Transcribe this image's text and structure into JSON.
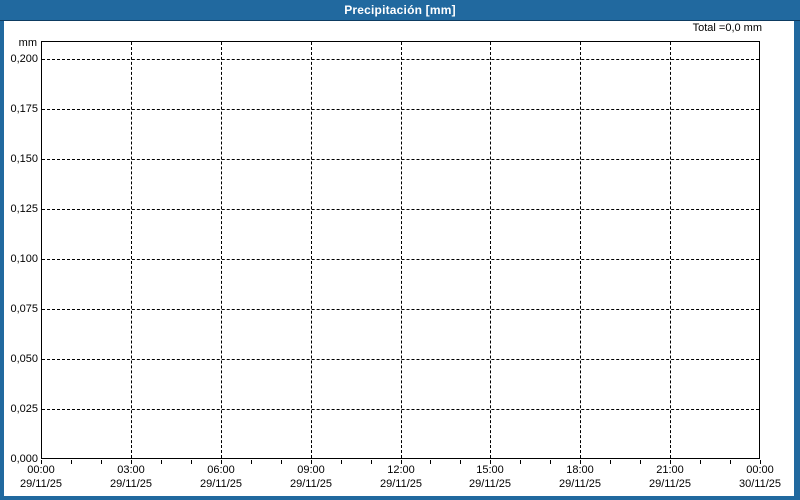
{
  "window": {
    "title": "Precipitación [mm]"
  },
  "header": {
    "total_label": "Total =0,0 mm"
  },
  "colors": {
    "titlebar_bg": "#21699f",
    "frame_border": "#21699f",
    "titlebar_underline": "#0d3b61",
    "title_text": "#ffffff",
    "plot_border": "#000000",
    "grid": "#000000",
    "text": "#000000",
    "background": "#ffffff"
  },
  "chart_data": {
    "type": "bar",
    "title": "Precipitación [mm]",
    "total_annotation": "Total =0,0 mm",
    "series": [
      {
        "name": "Precipitación",
        "values": [],
        "total_shown": "0,0 mm"
      }
    ],
    "x_axis": {
      "range": [
        "29/11/25 00:00",
        "30/11/25 00:00"
      ],
      "major_tick_every_hours": 3,
      "minor_tick_every_hours": 1,
      "total_hours": 24,
      "labels": [
        {
          "time": "00:00",
          "date": "29/11/25"
        },
        {
          "time": "03:00",
          "date": "29/11/25"
        },
        {
          "time": "06:00",
          "date": "29/11/25"
        },
        {
          "time": "09:00",
          "date": "29/11/25"
        },
        {
          "time": "12:00",
          "date": "29/11/25"
        },
        {
          "time": "15:00",
          "date": "29/11/25"
        },
        {
          "time": "18:00",
          "date": "29/11/25"
        },
        {
          "time": "21:00",
          "date": "29/11/25"
        },
        {
          "time": "00:00",
          "date": "30/11/25"
        }
      ]
    },
    "y_axis": {
      "unit": "mm",
      "min": 0,
      "max": 0.209,
      "tick_step": 0.025,
      "tick_labels_top_down": [
        "0,200",
        "0,175",
        "0,150",
        "0,125",
        "0,100",
        "0,075",
        "0,050",
        "0,025",
        "0,000"
      ],
      "decimal_separator": ","
    },
    "grid": {
      "style": "dashed",
      "horizontal": true,
      "vertical": true
    },
    "legend": "none"
  }
}
